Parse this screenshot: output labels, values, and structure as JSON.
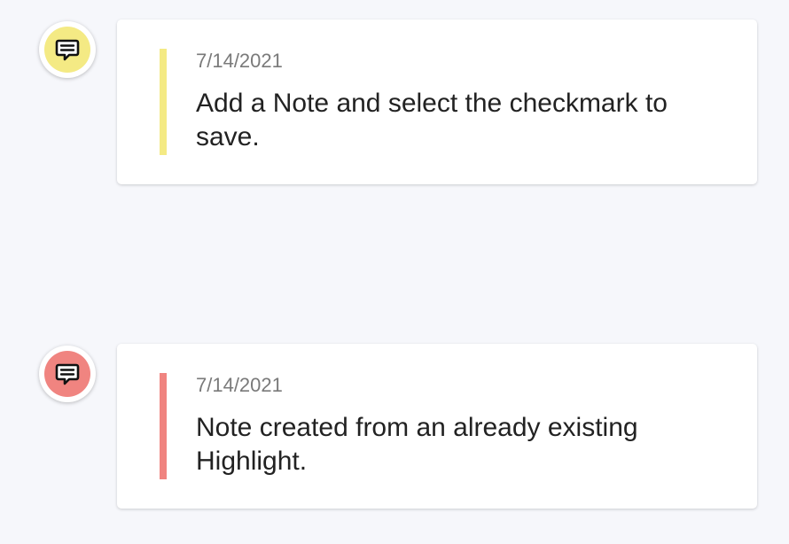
{
  "notes": [
    {
      "date": "7/14/2021",
      "text": "Add a Note and select the checkmark to save.",
      "color": "#f4ea84",
      "icon": "comment-icon"
    },
    {
      "date": "7/14/2021",
      "text": "Note created from an already existing Highlight.",
      "color": "#f08480",
      "icon": "comment-icon"
    }
  ]
}
